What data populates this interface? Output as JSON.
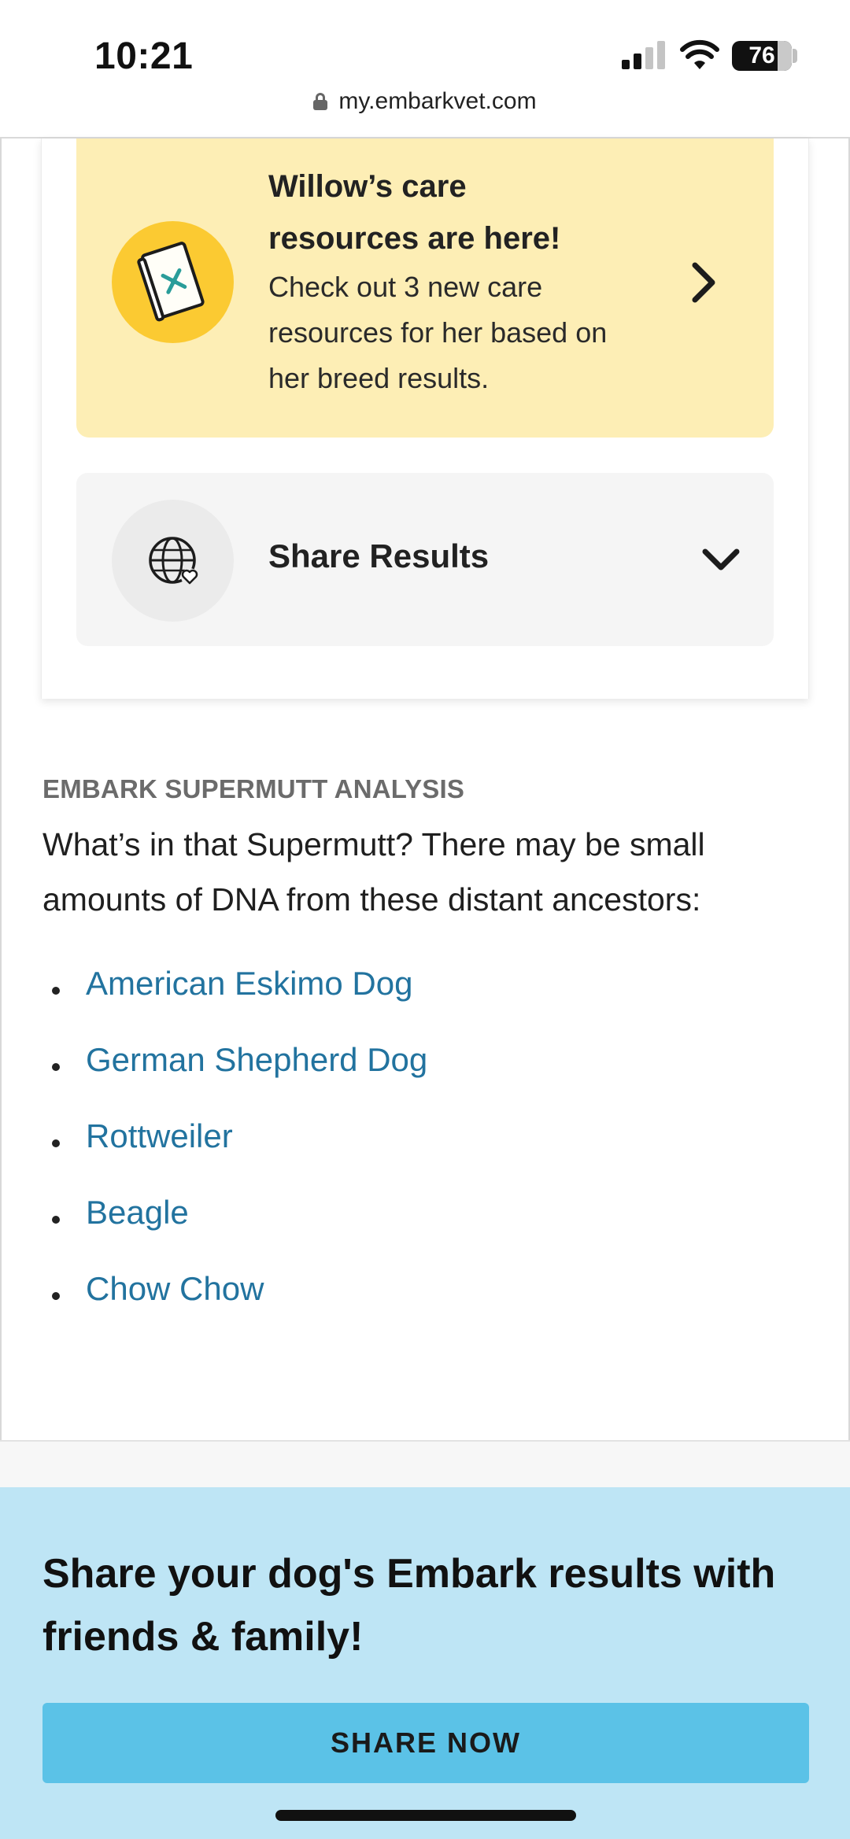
{
  "status_bar": {
    "time": "10:21",
    "battery": "76",
    "battery_level_percent": 76,
    "url": "my.embarkvet.com"
  },
  "care_card": {
    "title": "Willow’s care resources are here!",
    "body": "Check out 3 new care resources for her based on her breed results.",
    "icon": "care-book-icon",
    "accent_color": "#fbca32",
    "background_color": "#fdeeb5"
  },
  "share_results": {
    "label": "Share Results",
    "icon": "globe-heart-icon"
  },
  "supermutt": {
    "eyebrow": "EMBARK SUPERMUTT ANALYSIS",
    "intro": "What’s in that Supermutt? There may be small amounts of DNA from these distant ancestors:",
    "breeds": [
      "American Eskimo Dog",
      "German Shepherd Dog",
      "Rottweiler",
      "Beagle",
      "Chow Chow"
    ],
    "link_color": "#22739f"
  },
  "share_section": {
    "heading": "Share your dog's Embark results with friends & family!",
    "button_label": "SHARE NOW",
    "background_color": "#bee5f5",
    "button_color": "#5bc2e7"
  }
}
